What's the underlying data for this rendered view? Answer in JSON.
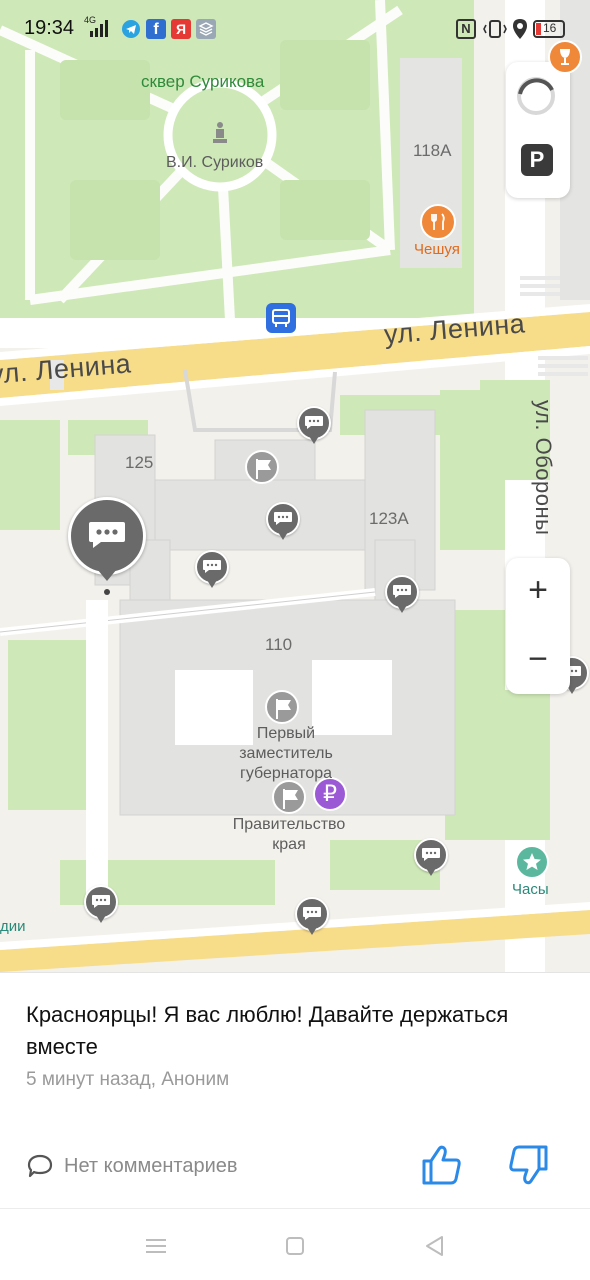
{
  "status_bar": {
    "time": "19:34",
    "network": "4G",
    "battery": "16"
  },
  "map": {
    "park_label": "сквер Сурикова",
    "monument_label": "В.И. Суриков",
    "street_lenina_right": "ул. Ленина",
    "street_lenina_left": "ул. Ленина",
    "street_oborony": "ул. Обороны",
    "building_118a": "118А",
    "building_125": "125",
    "building_123a": "123А",
    "building_110": "110",
    "poi_cheshuya": "Чешуя",
    "poi_first_deputy": "Первый заместитель губернатора",
    "poi_government": "Правительство края",
    "poi_clock": "Часы",
    "poi_left_edge": "дии",
    "parking_label": "P",
    "zoom_in": "+",
    "zoom_out": "−",
    "colors": {
      "park": "#cfe8b8",
      "road_main": "#f7dc8a",
      "building": "#e2e2e0",
      "pin": "#6a6a6a",
      "ruble_pin": "#9b59d6",
      "transit": "#2f6fe0",
      "cheshuya": "#f0883a",
      "clock": "#5bb89f"
    }
  },
  "post": {
    "text": "Красноярцы! Я вас люблю! Давайте держаться вместе",
    "meta": "5 минут назад, Аноним",
    "comments_label": "Нет комментариев",
    "accent_color": "#2b8ae8"
  },
  "icons": {
    "comments": "speech-bubble-icon",
    "like": "thumbs-up-icon",
    "dislike": "thumbs-down-icon"
  }
}
